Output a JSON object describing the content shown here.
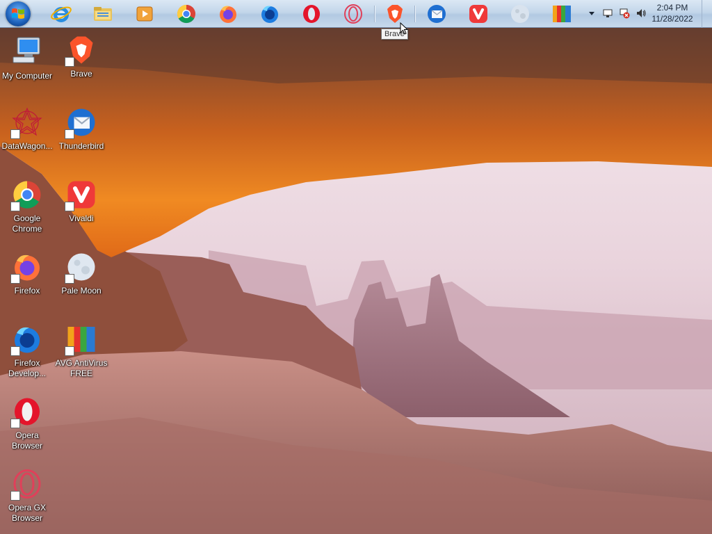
{
  "taskbar": {
    "pinned": [
      {
        "name": "Internet Explorer"
      },
      {
        "name": "File Explorer"
      },
      {
        "name": "Windows Media Player"
      },
      {
        "name": "Google Chrome"
      },
      {
        "name": "Firefox"
      },
      {
        "name": "Firefox Developer Edition"
      },
      {
        "name": "Opera"
      },
      {
        "name": "Opera GX"
      },
      {
        "name": "Brave"
      },
      {
        "name": "Thunderbird"
      },
      {
        "name": "Vivaldi"
      },
      {
        "name": "Pale Moon"
      },
      {
        "name": "AVG AntiVirus"
      }
    ],
    "tooltip": "Brave",
    "clock": {
      "time": "2:04 PM",
      "date": "11/28/2022"
    }
  },
  "desktop": {
    "icons": [
      {
        "label": "My Computer"
      },
      {
        "label": "Brave"
      },
      {
        "label": "DataWagon..."
      },
      {
        "label": "Thunderbird"
      },
      {
        "label": "Google Chrome"
      },
      {
        "label": "Vivaldi"
      },
      {
        "label": "Firefox"
      },
      {
        "label": "Pale Moon"
      },
      {
        "label": "Firefox Develop..."
      },
      {
        "label": "AVG AntiVirus FREE"
      },
      {
        "label": "Opera Browser"
      },
      {
        "label": "Opera GX Browser"
      }
    ]
  }
}
